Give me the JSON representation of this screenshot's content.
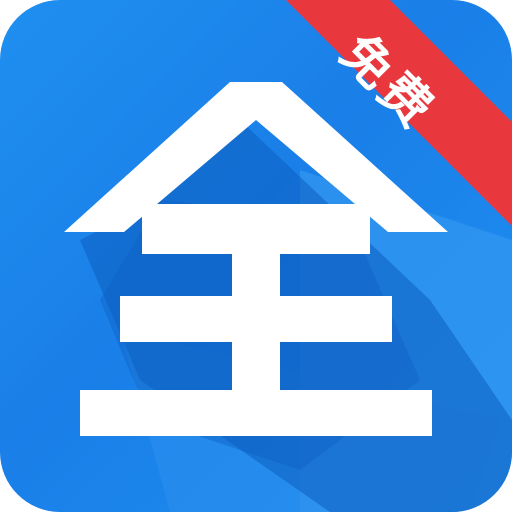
{
  "app_icon": {
    "main_character": "全",
    "corner_badge": "免费",
    "colors": {
      "background": "#1a82ea",
      "background_light": "#3aa0f5",
      "shadow": "#0f5fbf",
      "glyph": "#ffffff",
      "ribbon": "#e8383d"
    }
  }
}
